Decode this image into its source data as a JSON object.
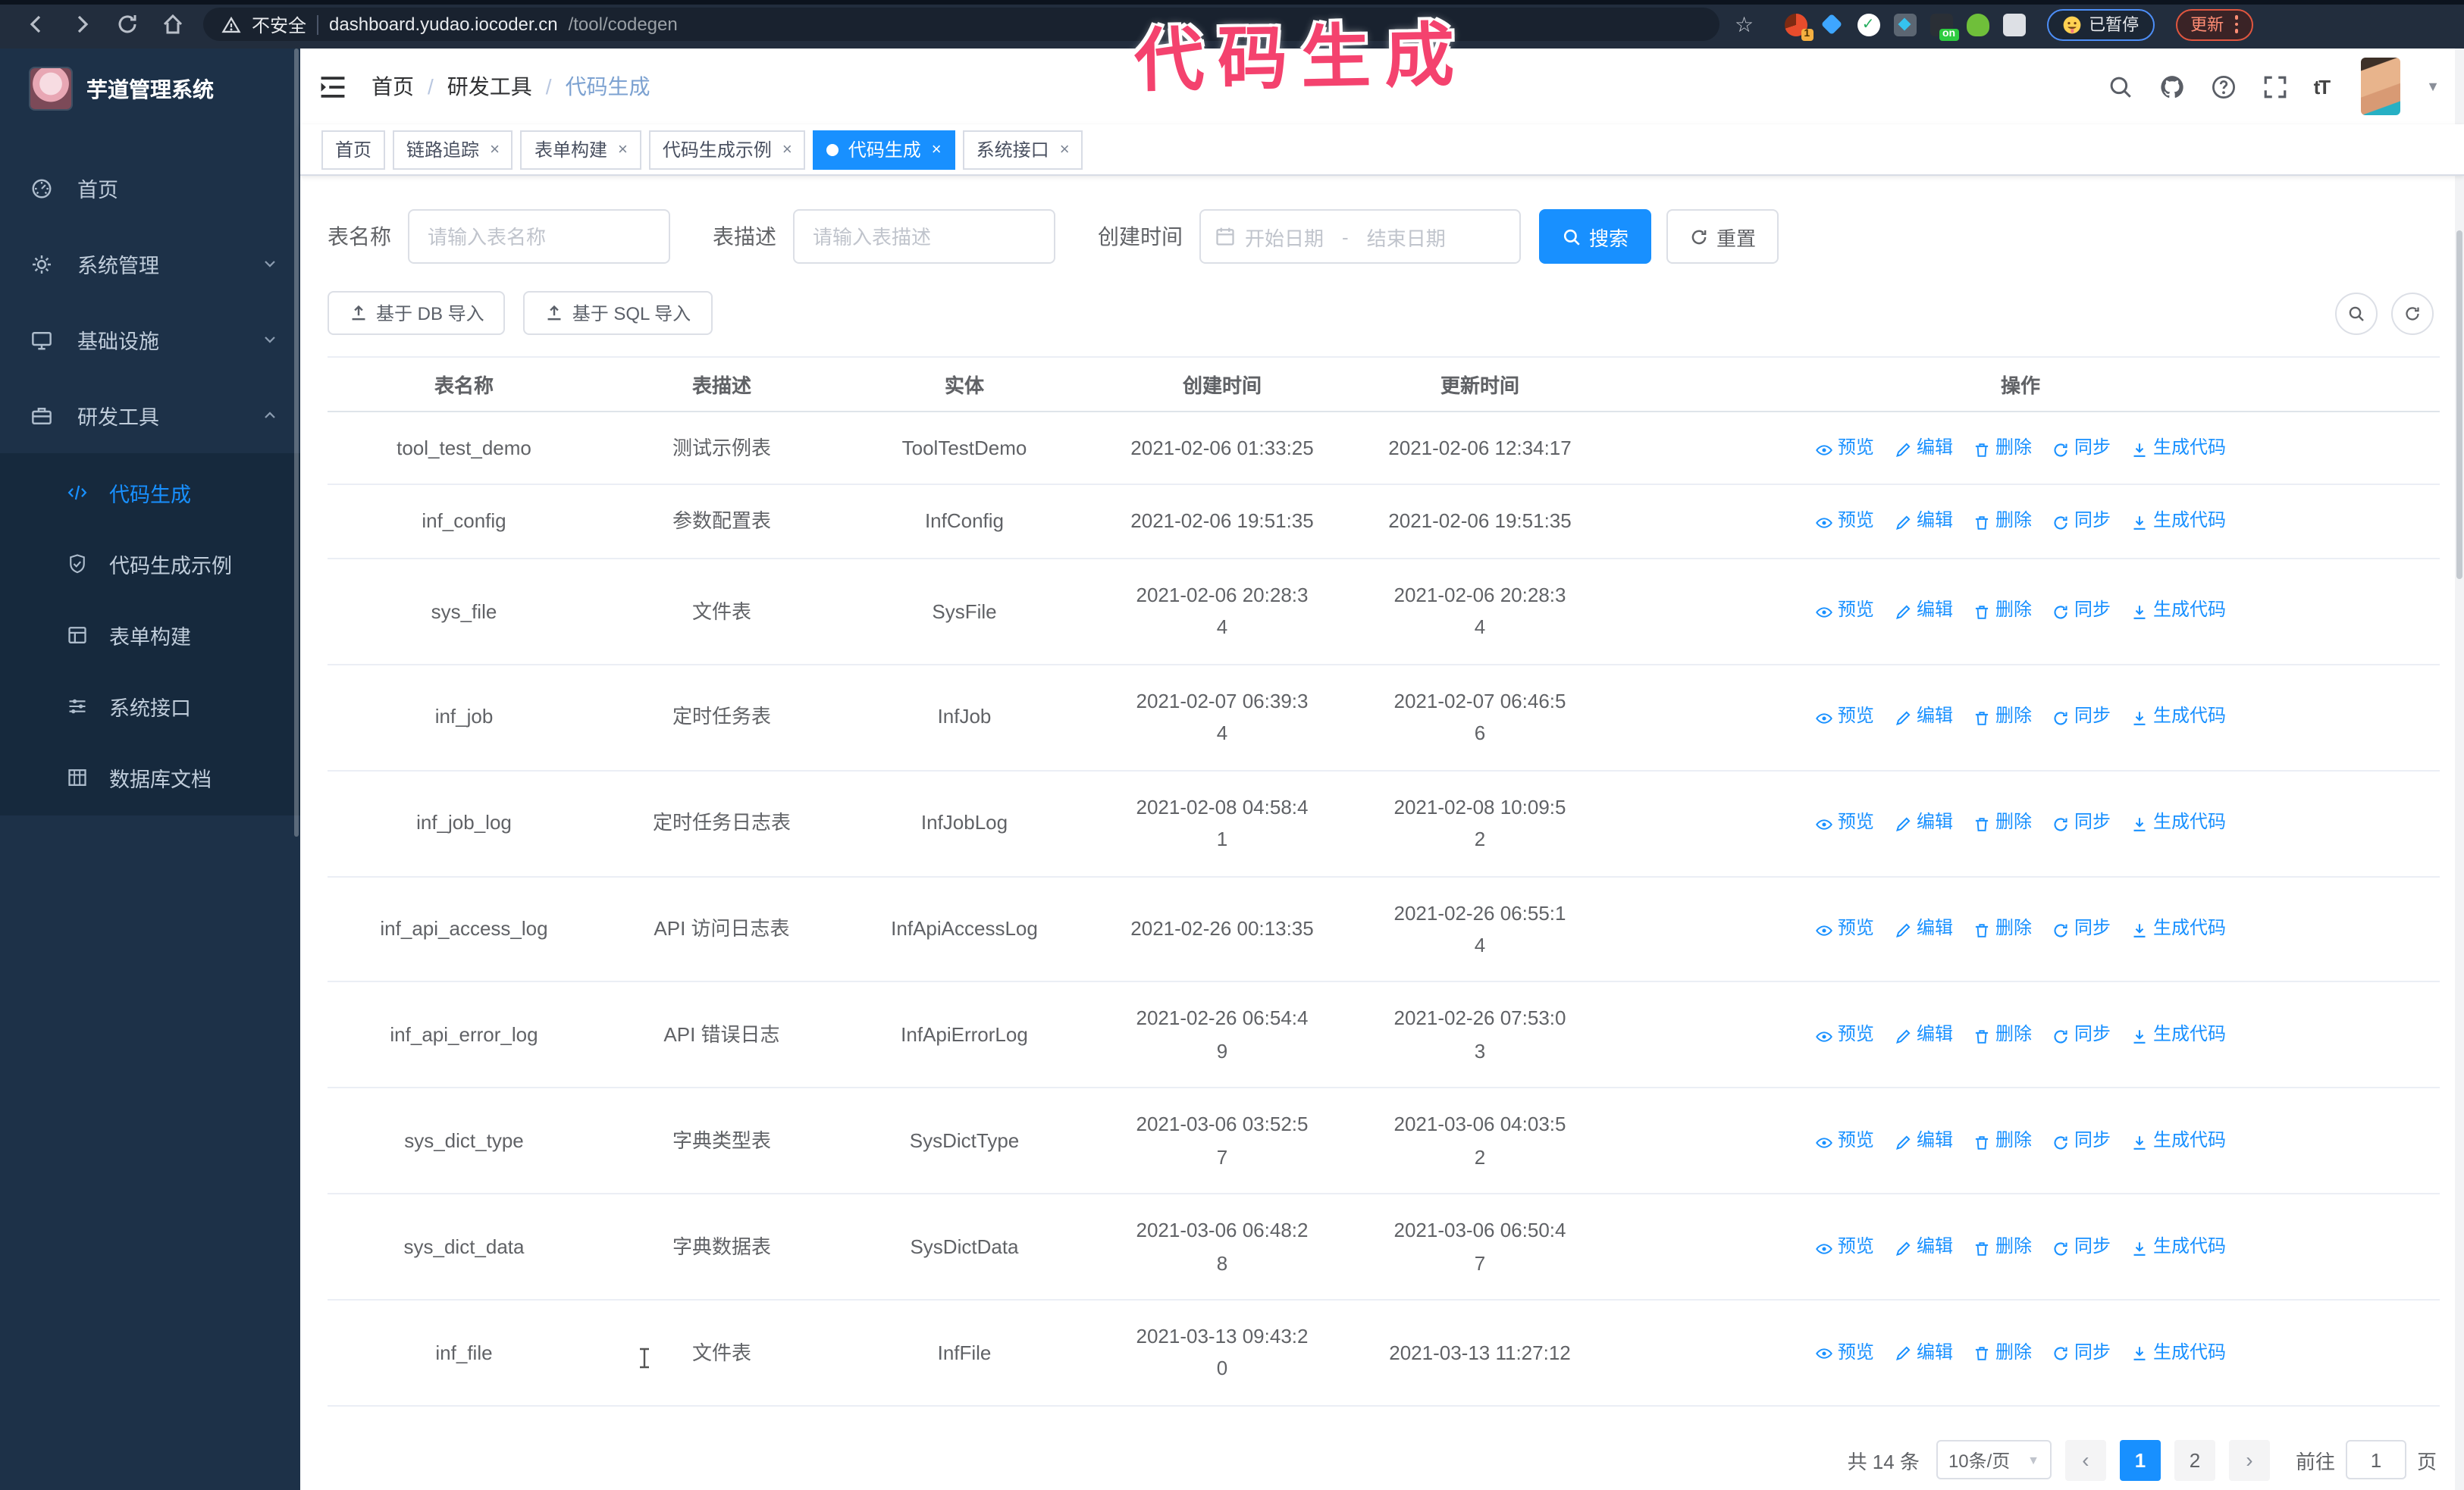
{
  "annotation": {
    "text": "代码生成"
  },
  "colors": {
    "accent": "#1890ff",
    "sidebar_bg": "#1d3148",
    "submenu_bg": "#16293d",
    "annotation": "#f4426e"
  },
  "browser": {
    "insecure_label": "不安全",
    "url_host": "dashboard.yudao.iocoder.cn",
    "url_path": "/tool/codegen",
    "extension_badge_1": "1",
    "extension_badge_on": "on",
    "paused_badge": "已暂停",
    "update_badge": "更新"
  },
  "sidebar": {
    "title": "芋道管理系统",
    "items": [
      {
        "name": "home",
        "label": "首页",
        "icon": "dashboard"
      },
      {
        "name": "system",
        "label": "系统管理",
        "icon": "gear",
        "chevron": "down"
      },
      {
        "name": "infra",
        "label": "基础设施",
        "icon": "monitor",
        "chevron": "down"
      },
      {
        "name": "devtools",
        "label": "研发工具",
        "icon": "tool",
        "chevron": "up"
      }
    ],
    "subitems": [
      {
        "name": "codegen",
        "label": "代码生成",
        "icon": "code",
        "active": true
      },
      {
        "name": "codegen-demo",
        "label": "代码生成示例",
        "icon": "shield"
      },
      {
        "name": "form-builder",
        "label": "表单构建",
        "icon": "form"
      },
      {
        "name": "api",
        "label": "系统接口",
        "icon": "sliders"
      },
      {
        "name": "db-doc",
        "label": "数据库文档",
        "icon": "dbdoc"
      }
    ]
  },
  "header": {
    "breadcrumb": [
      "首页",
      "研发工具",
      "代码生成"
    ]
  },
  "tabs": [
    {
      "name": "home",
      "label": "首页",
      "closable": false,
      "active": false
    },
    {
      "name": "trace",
      "label": "链路追踪",
      "closable": true,
      "active": false
    },
    {
      "name": "form-builder",
      "label": "表单构建",
      "closable": true,
      "active": false
    },
    {
      "name": "codegen-demo",
      "label": "代码生成示例",
      "closable": true,
      "active": false
    },
    {
      "name": "codegen",
      "label": "代码生成",
      "closable": true,
      "active": true
    },
    {
      "name": "api",
      "label": "系统接口",
      "closable": true,
      "active": false
    }
  ],
  "filters": {
    "table_name_label": "表名称",
    "table_name_placeholder": "请输入表名称",
    "table_desc_label": "表描述",
    "table_desc_placeholder": "请输入表描述",
    "create_time_label": "创建时间",
    "date_start_placeholder": "开始日期",
    "date_separator": "-",
    "date_end_placeholder": "结束日期",
    "search_label": "搜索",
    "reset_label": "重置"
  },
  "toolbar": {
    "import_db_label": "基于 DB 导入",
    "import_sql_label": "基于 SQL 导入"
  },
  "table": {
    "columns": [
      "表名称",
      "表描述",
      "实体",
      "创建时间",
      "更新时间",
      "操作"
    ],
    "actions": [
      "预览",
      "编辑",
      "删除",
      "同步",
      "生成代码"
    ],
    "rows": [
      {
        "name": "tool_test_demo",
        "desc": "测试示例表",
        "entity": "ToolTestDemo",
        "created": "2021-02-06 01:33:25",
        "updated": "2021-02-06 12:34:17"
      },
      {
        "name": "inf_config",
        "desc": "参数配置表",
        "entity": "InfConfig",
        "created": "2021-02-06 19:51:35",
        "updated": "2021-02-06 19:51:35"
      },
      {
        "name": "sys_file",
        "desc": "文件表",
        "entity": "SysFile",
        "created": "2021-02-06 20:28:3\n4",
        "updated": "2021-02-06 20:28:3\n4"
      },
      {
        "name": "inf_job",
        "desc": "定时任务表",
        "entity": "InfJob",
        "created": "2021-02-07 06:39:3\n4",
        "updated": "2021-02-07 06:46:5\n6"
      },
      {
        "name": "inf_job_log",
        "desc": "定时任务日志表",
        "entity": "InfJobLog",
        "created": "2021-02-08 04:58:4\n1",
        "updated": "2021-02-08 10:09:5\n2"
      },
      {
        "name": "inf_api_access_log",
        "desc": "API 访问日志表",
        "entity": "InfApiAccessLog",
        "created": "2021-02-26 00:13:35",
        "updated": "2021-02-26 06:55:1\n4"
      },
      {
        "name": "inf_api_error_log",
        "desc": "API 错误日志",
        "entity": "InfApiErrorLog",
        "created": "2021-02-26 06:54:4\n9",
        "updated": "2021-02-26 07:53:0\n3"
      },
      {
        "name": "sys_dict_type",
        "desc": "字典类型表",
        "entity": "SysDictType",
        "created": "2021-03-06 03:52:5\n7",
        "updated": "2021-03-06 04:03:5\n2"
      },
      {
        "name": "sys_dict_data",
        "desc": "字典数据表",
        "entity": "SysDictData",
        "created": "2021-03-06 06:48:2\n8",
        "updated": "2021-03-06 06:50:4\n7"
      },
      {
        "name": "inf_file",
        "desc": "文件表",
        "entity": "InfFile",
        "created": "2021-03-13 09:43:2\n0",
        "updated": "2021-03-13 11:27:12"
      }
    ]
  },
  "pagination": {
    "total": "共 14 条",
    "page_size": "10条/页",
    "pages": [
      "1",
      "2"
    ],
    "active_page": "1",
    "goto_label": "前往",
    "goto_value": "1",
    "goto_suffix": "页"
  }
}
